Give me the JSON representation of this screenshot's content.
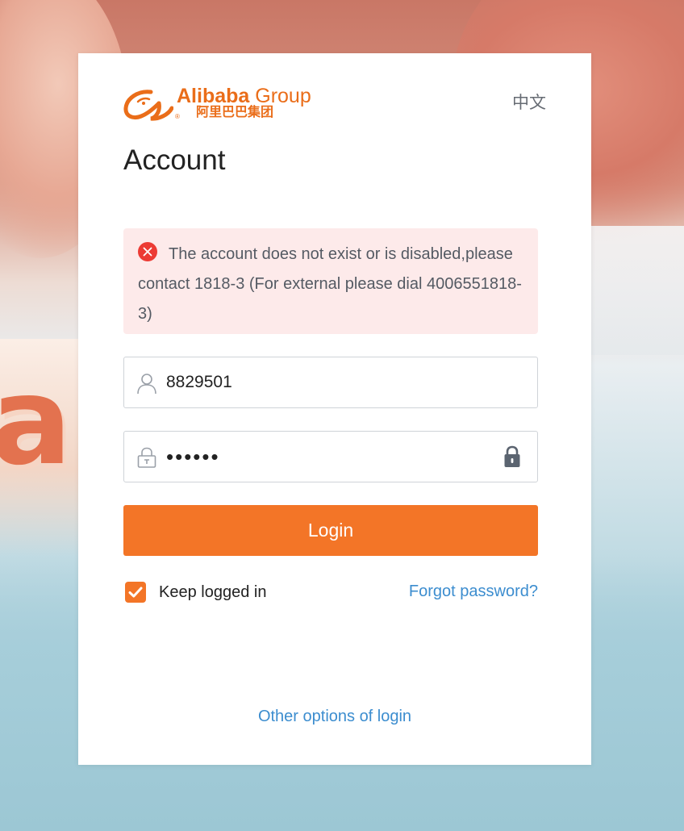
{
  "brand": {
    "name_en_bold": "Alibaba",
    "name_en_rest": " Group",
    "name_cn": "阿里巴巴集团",
    "reg_mark": "®",
    "accent_color": "#f37527"
  },
  "header": {
    "language_link": "中文"
  },
  "page": {
    "title": "Account"
  },
  "error": {
    "icon": "close-circle-icon",
    "message": "The account does not exist or is disabled,please contact 1818-3 (For external please dial 4006551818-3)"
  },
  "form": {
    "username": {
      "value": "8829501",
      "icon": "user-icon"
    },
    "password": {
      "value": "••••••",
      "icon": "lock-icon",
      "toggle_icon": "padlock-icon"
    },
    "login_label": "Login",
    "keep_logged_in": {
      "label": "Keep logged in",
      "checked": true
    },
    "forgot_label": "Forgot password?"
  },
  "footer": {
    "other_options_label": "Other options of login"
  }
}
